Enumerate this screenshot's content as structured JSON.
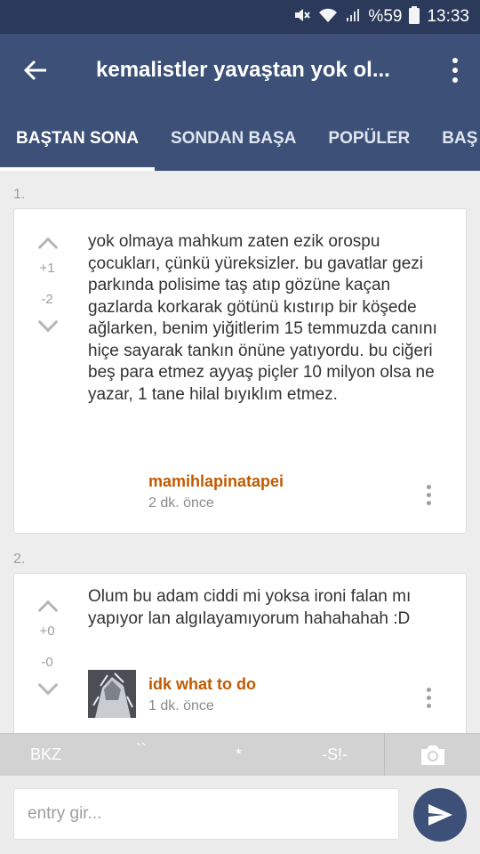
{
  "status_bar": {
    "battery": "%59",
    "time": "13:33",
    "icons": [
      "mute-icon",
      "wifi-icon",
      "signal-icon",
      "battery-icon"
    ]
  },
  "app_bar": {
    "title": "kemalistler yavaştan yok ol...",
    "back_icon": "arrow-left-icon",
    "menu_icon": "more-vert-icon"
  },
  "tabs": [
    {
      "label": "BAŞTAN SONA",
      "active": true
    },
    {
      "label": "SONDAN BAŞA",
      "active": false
    },
    {
      "label": "POPÜLER",
      "active": false
    },
    {
      "label": "BAŞ",
      "active": false
    }
  ],
  "entries": [
    {
      "number": "1.",
      "upvotes": "+1",
      "downvotes": "-2",
      "text": "yok olmaya mahkum zaten ezik orospu çocukları, çünkü yüreksizler. bu gavatlar gezi parkında polisime taş atıp gözüne kaçan gazlarda korkarak götünü kıstırıp bir köşede ağlarken, benim yiğitlerim 15 temmuzda canını hiçe sayarak tankın önüne yatıyordu. bu ciğeri beş para etmez ayyaş piçler 10 milyon olsa ne yazar, 1 tane hilal bıyıklım etmez.",
      "author": "mamihlapinatapei",
      "time": "2 dk. önce"
    },
    {
      "number": "2.",
      "upvotes": "+0",
      "downvotes": "-0",
      "text": "Olum bu adam ciddi mi yoksa ironi falan mı yapıyor lan algılayamıyorum hahahahah :D",
      "author": "idk what to do",
      "time": "1 dk. önce"
    }
  ],
  "format_toolbar": {
    "bkz": "BKZ",
    "backticks": "``",
    "asterisk": "*",
    "spoiler": "-S!-",
    "camera_icon": "camera-icon"
  },
  "compose": {
    "placeholder": "entry gir...",
    "value": "",
    "send_icon": "send-icon"
  },
  "colors": {
    "appbar": "#3c5078",
    "statusbar": "#2b3a5a",
    "author": "#c05a00",
    "background": "#ededed"
  }
}
